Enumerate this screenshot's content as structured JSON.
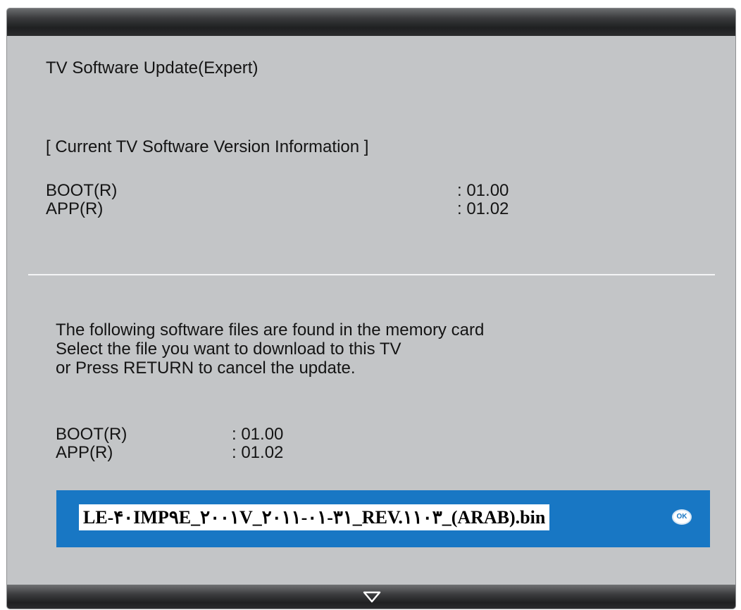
{
  "screen": {
    "title": "TV Software Update(Expert)"
  },
  "current_info": {
    "heading": "[ Current TV Software Version Information ]",
    "rows": [
      {
        "label": "BOOT(R)",
        "value": ": 01.00"
      },
      {
        "label": "APP(R)",
        "value": ": 01.02"
      }
    ]
  },
  "instructions": {
    "lines": [
      "The following software files are found in the memory card",
      "Select the file you want to download to this TV",
      "or Press RETURN to cancel the update."
    ]
  },
  "found_file": {
    "rows": [
      {
        "label": "BOOT(R)",
        "value": ": 01.00"
      },
      {
        "label": "APP(R)",
        "value": ": 01.02"
      }
    ],
    "file_name": "LE-۴۰IMP۹E_۲۰۰۱V_۲۰۱۱-۰۱-۳۱_REV.۱۱۰۳_(ARAB).bin",
    "ok_label": "OK"
  },
  "icons": {
    "ok": "ok-button-icon",
    "scroll": "down-triangle-icon"
  },
  "colors": {
    "panel_background": "#c3c5c7",
    "selection_highlight": "#1877c4",
    "header_bar": "#1f2021",
    "divider": "#f4f5f6"
  }
}
